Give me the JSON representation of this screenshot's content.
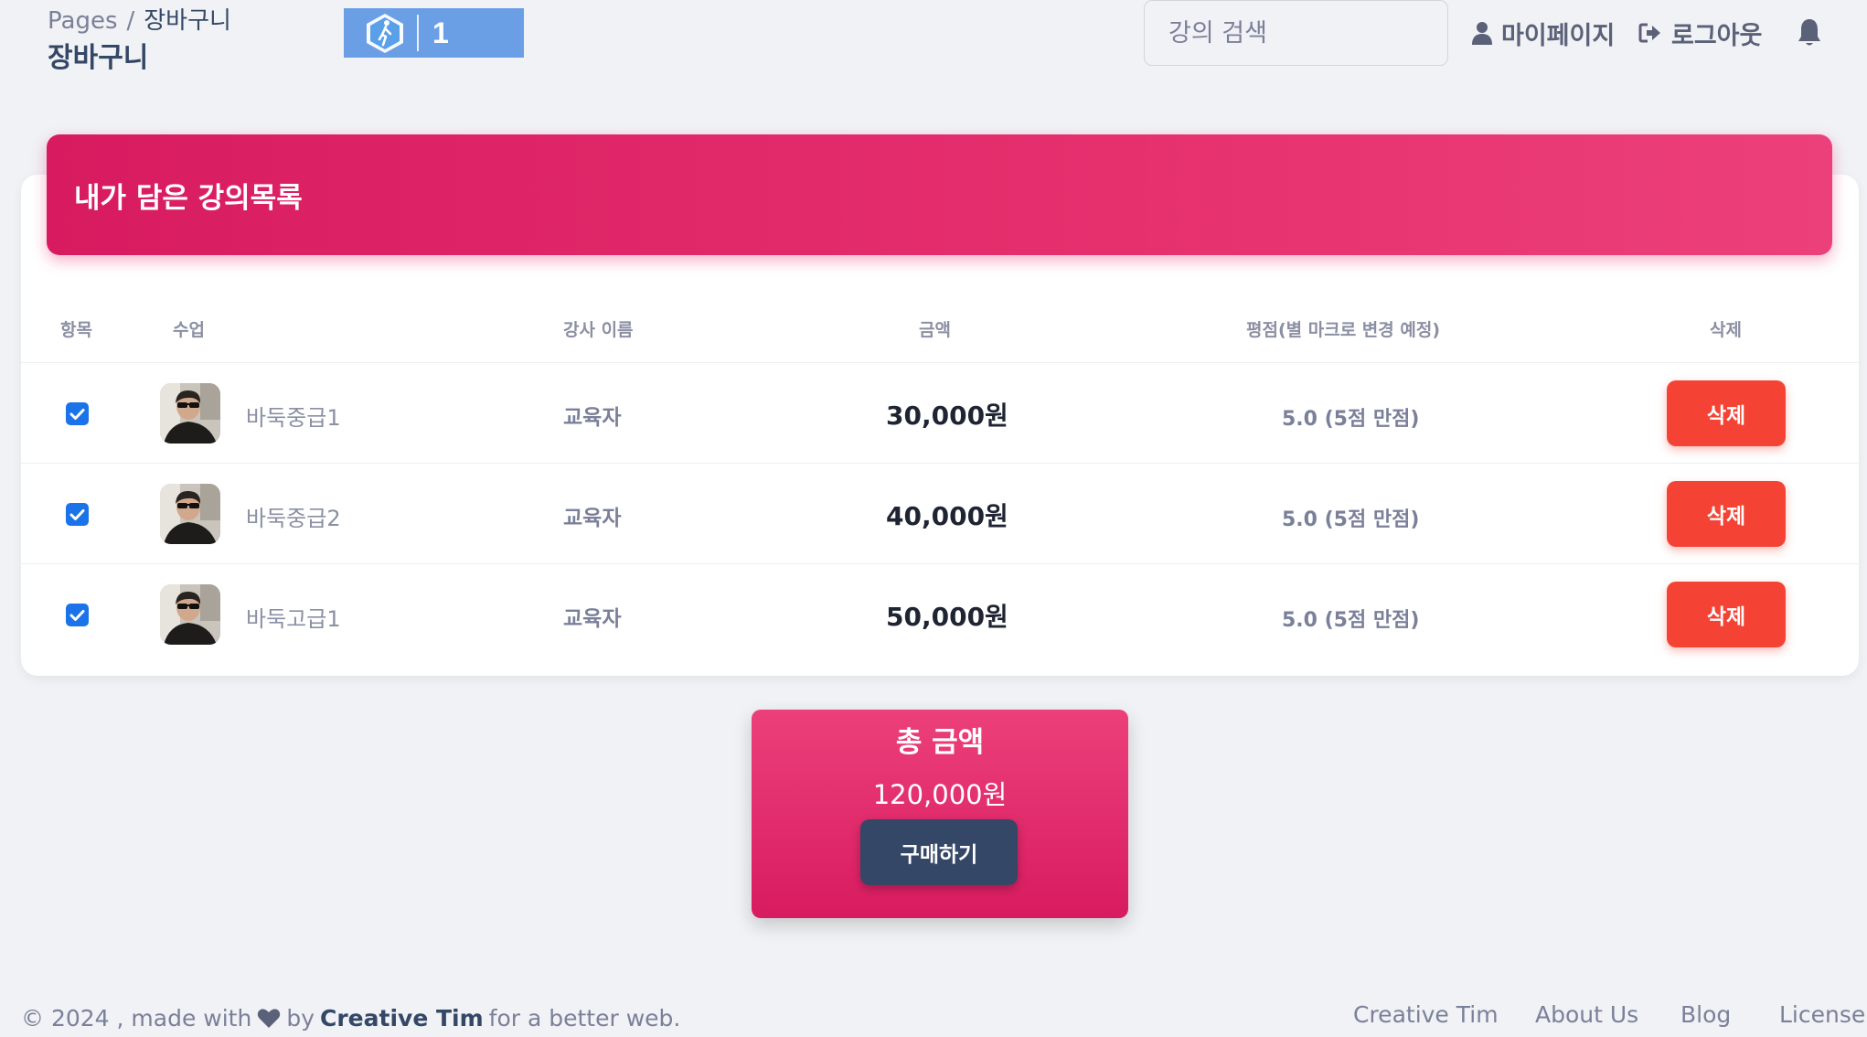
{
  "breadcrumb": {
    "root": "Pages",
    "separator": "/",
    "current": "장바구니"
  },
  "page_title": "장바구니",
  "badge": {
    "icon": "walking-hexagon-icon",
    "count": "1"
  },
  "search": {
    "placeholder": "강의 검색"
  },
  "nav": {
    "mypage": "마이페이지",
    "logout": "로그아웃"
  },
  "card": {
    "title": "내가 담은 강의목록",
    "columns": [
      "항목",
      "수업",
      "강사 이름",
      "금액",
      "평점(별 마크로 변경 예정)",
      "삭제"
    ],
    "rows": [
      {
        "checked": true,
        "course": "바둑중급1",
        "teacher": "교육자",
        "price": "30,000원",
        "rating": "5.0 (5점 만점)",
        "delete": "삭제"
      },
      {
        "checked": true,
        "course": "바둑중급2",
        "teacher": "교육자",
        "price": "40,000원",
        "rating": "5.0 (5점 만점)",
        "delete": "삭제"
      },
      {
        "checked": true,
        "course": "바둑고급1",
        "teacher": "교육자",
        "price": "50,000원",
        "rating": "5.0 (5점 만점)",
        "delete": "삭제"
      }
    ]
  },
  "total": {
    "title": "총 금액",
    "amount": "120,000원",
    "buy": "구매하기"
  },
  "footer": {
    "copyright": "© 2024 , made with",
    "by": "by",
    "brand": "Creative Tim",
    "tail": "for a better web.",
    "links": [
      "Creative Tim",
      "About Us",
      "Blog",
      "License"
    ]
  },
  "colors": {
    "accent_pink": "#e91e63",
    "danger": "#f44335",
    "dark": "#344767",
    "checkbox": "#1a73e8",
    "badge_blue": "#6a9fe6"
  }
}
